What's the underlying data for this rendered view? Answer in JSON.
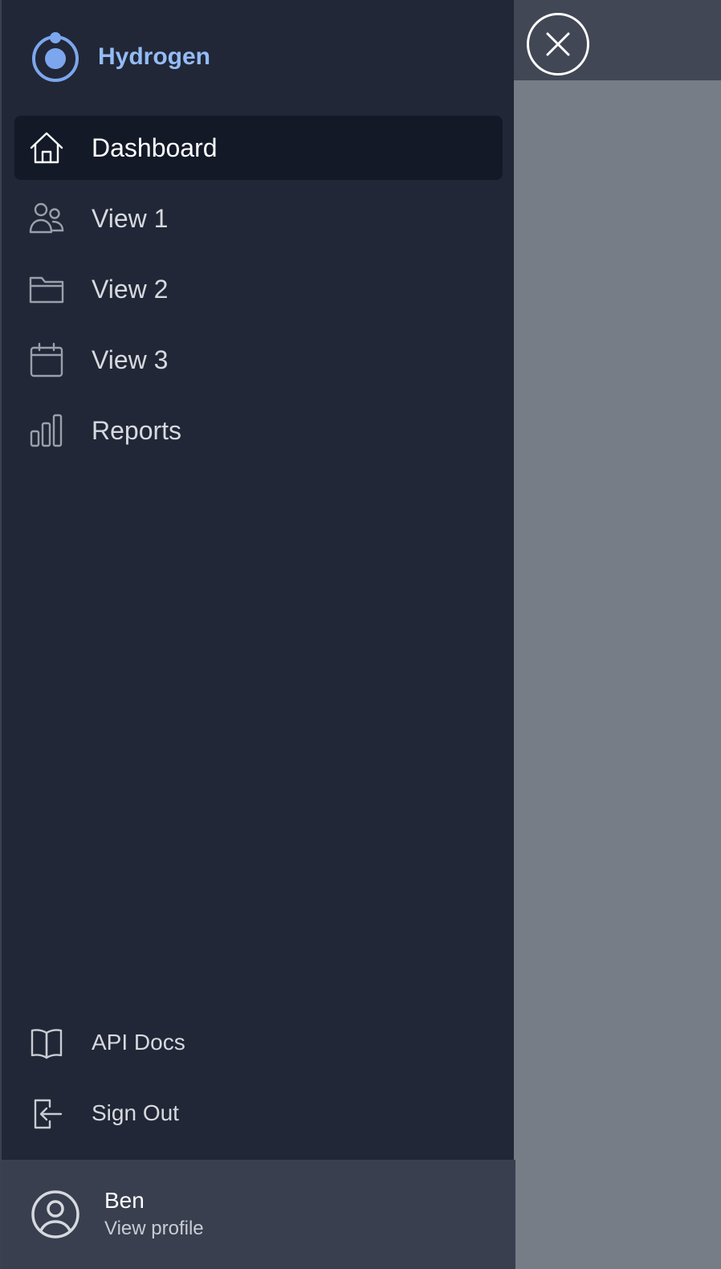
{
  "app": {
    "name": "Hydrogen",
    "brand_color": "#94bbf6",
    "logo_icon": "hydrogen-logo-icon"
  },
  "nav": {
    "items": [
      {
        "label": "Dashboard",
        "icon": "home-icon",
        "active": true
      },
      {
        "label": "View 1",
        "icon": "users-icon",
        "active": false
      },
      {
        "label": "View 2",
        "icon": "folder-icon",
        "active": false
      },
      {
        "label": "View 3",
        "icon": "calendar-icon",
        "active": false
      },
      {
        "label": "Reports",
        "icon": "bar-chart-icon",
        "active": false
      }
    ]
  },
  "secondary": {
    "items": [
      {
        "label": "API Docs",
        "icon": "book-open-icon"
      },
      {
        "label": "Sign Out",
        "icon": "sign-out-icon"
      }
    ]
  },
  "profile": {
    "name": "Ben",
    "link_label": "View profile",
    "icon": "user-circle-icon"
  },
  "close_button": {
    "icon": "close-icon"
  },
  "colors": {
    "sidebar_bg": "#212736",
    "active_item_bg": "#131927",
    "profile_bg": "#393f4f",
    "overlay": "#777d87"
  }
}
